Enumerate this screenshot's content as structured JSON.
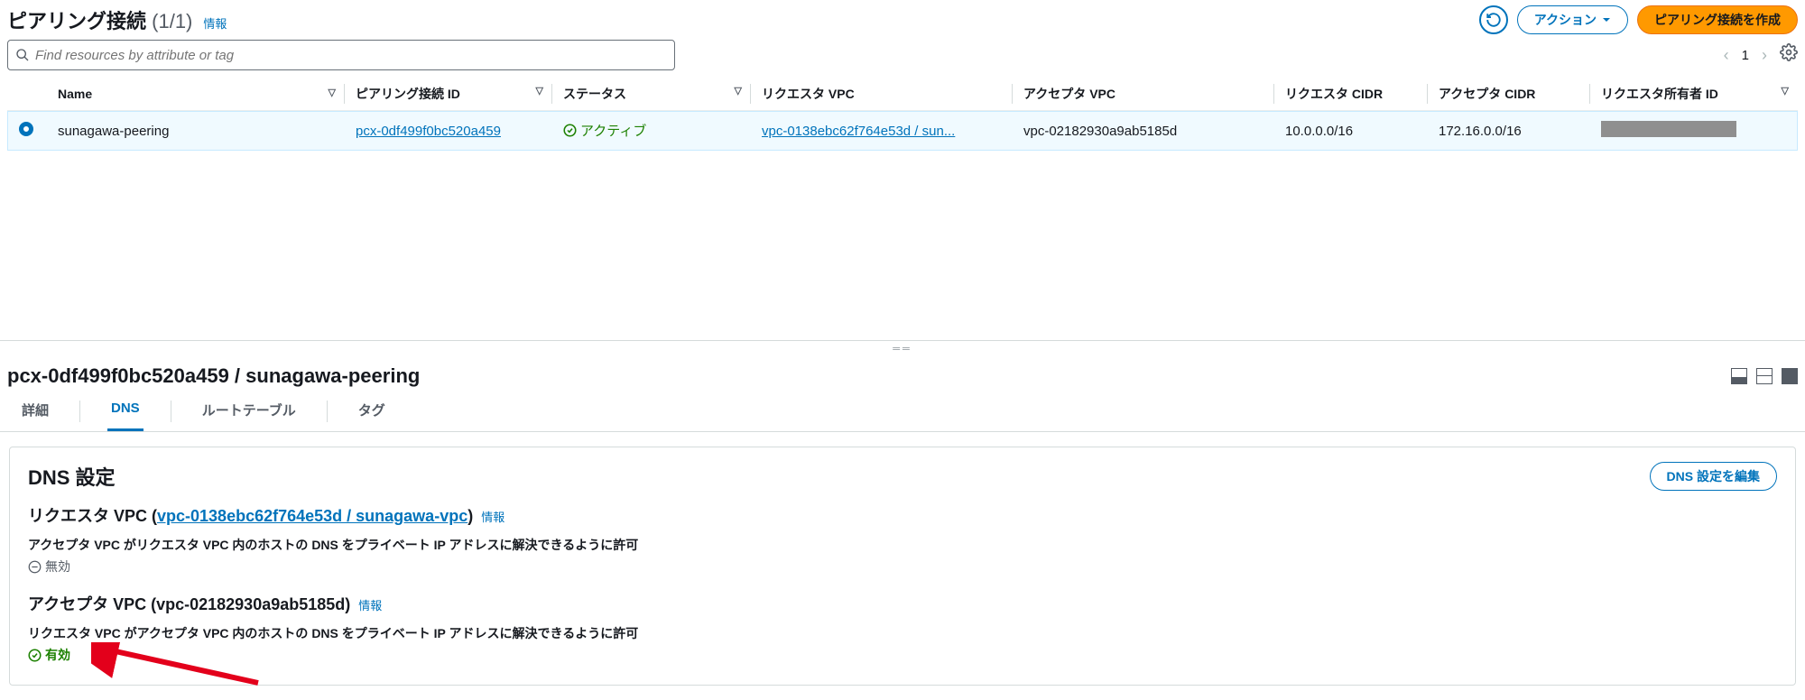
{
  "header": {
    "title": "ピアリング接続",
    "count": "(1/1)",
    "info": "情報",
    "actions": "アクション",
    "create": "ピアリング接続を作成"
  },
  "search": {
    "placeholder": "Find resources by attribute or tag"
  },
  "pager": {
    "page": "1"
  },
  "columns": {
    "name": "Name",
    "peering_id": "ピアリング接続 ID",
    "status": "ステータス",
    "requester_vpc": "リクエスタ VPC",
    "accepter_vpc": "アクセプタ VPC",
    "requester_cidr": "リクエスタ CIDR",
    "accepter_cidr": "アクセプタ CIDR",
    "requester_owner": "リクエスタ所有者 ID"
  },
  "rows": [
    {
      "name": "sunagawa-peering",
      "peering_id": "pcx-0df499f0bc520a459",
      "status": "アクティブ",
      "requester_vpc": "vpc-0138ebc62f764e53d / sun...",
      "accepter_vpc": "vpc-02182930a9ab5185d",
      "requester_cidr": "10.0.0.0/16",
      "accepter_cidr": "172.16.0.0/16"
    }
  ],
  "detail": {
    "title": "pcx-0df499f0bc520a459 / sunagawa-peering",
    "tabs": {
      "detail": "詳細",
      "dns": "DNS",
      "route": "ルートテーブル",
      "tag": "タグ"
    },
    "dns": {
      "panel_title": "DNS 設定",
      "edit": "DNS 設定を編集",
      "requester_label_pre": "リクエスタ VPC (",
      "requester_link": "vpc-0138ebc62f764e53d / sunagawa-vpc",
      "requester_label_post": ")",
      "info": "情報",
      "requester_desc": "アクセプタ VPC がリクエスタ VPC 内のホストの DNS をプライベート IP アドレスに解決できるように許可",
      "disabled": "無効",
      "accepter_label": "アクセプタ VPC (vpc-02182930a9ab5185d)",
      "accepter_desc": "リクエスタ VPC がアクセプタ VPC 内のホストの DNS をプライベート IP アドレスに解決できるように許可",
      "enabled": "有効"
    }
  }
}
